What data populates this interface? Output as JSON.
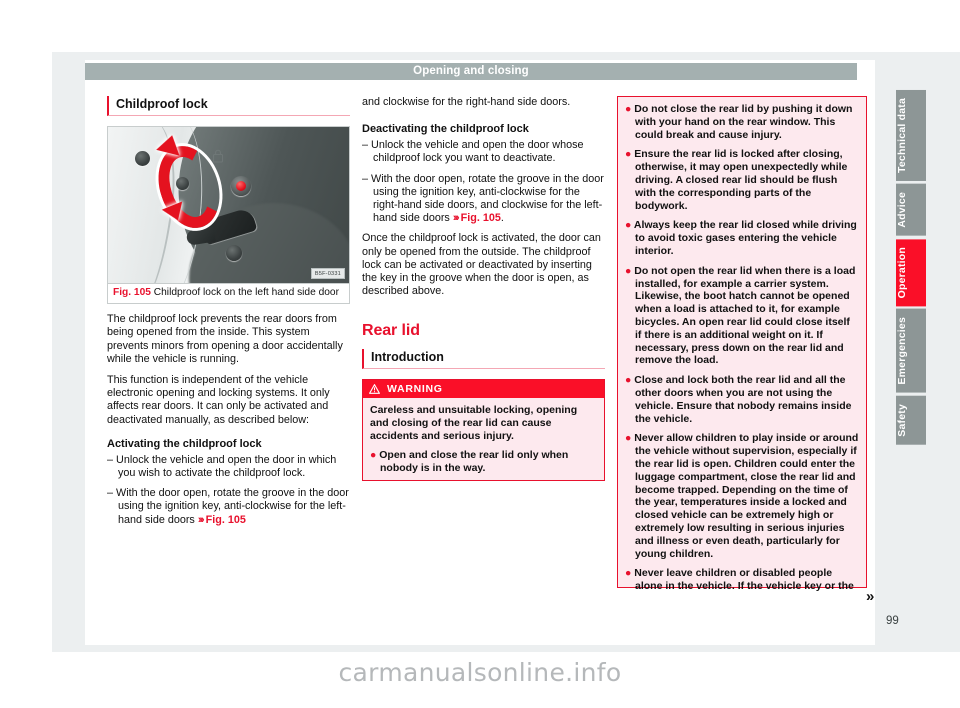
{
  "header": {
    "chapter_title": "Opening and closing"
  },
  "page_number": "99",
  "watermark": "carmanualsonline.info",
  "continuation_marker": "»",
  "left_column": {
    "heading": "Childproof lock",
    "figure": {
      "number": "Fig. 105",
      "caption": "Childproof lock on the left hand side door",
      "image_code": "B5F-0331",
      "alt": "Childproof lock groove on the left hand side door jamb with red rotation arrow"
    },
    "paragraph_1": "The childproof lock prevents the rear doors from being opened from the inside. This system prevents minors from opening a door accidentally while the vehicle is running.",
    "paragraph_2": "This function is independent of the vehicle electronic opening and locking systems. It only affects rear doors. It can only be activated and deactivated manually, as described below:",
    "subheading": "Activating the childproof lock",
    "items": [
      {
        "dash": "–",
        "text": "Unlock the vehicle and open the door in which you wish to activate the childproof lock."
      },
      {
        "dash": "–",
        "text_before": "With the door open, rotate the groove in the door using the ignition key, anti-clockwise for the left-hand side doors ",
        "chevron": "›››",
        "ref": "Fig. 105",
        "text_after": ""
      }
    ]
  },
  "middle_column": {
    "continuation_text": "and clockwise for the right-hand side doors.",
    "subheading": "Deactivating the childproof lock",
    "items": [
      {
        "dash": "–",
        "text": "Unlock the vehicle and open the door whose childproof lock you want to deactivate."
      },
      {
        "dash": "–",
        "text_before": "With the door open, rotate the groove in the door using the ignition key, anti-clockwise for the right-hand side doors, and clockwise for the left-hand side doors ",
        "chevron": "›››",
        "ref": "Fig. 105",
        "text_after": "."
      }
    ],
    "paragraph": "Once the childproof lock is activated, the door can only be opened from the outside. The childproof lock can be activated or deactivated by inserting the key in the groove when the door is open, as described above.",
    "section_heading": "Rear lid",
    "sub_section_heading": "Introduction",
    "warning": {
      "label": "WARNING",
      "icon": "warning-triangle-icon",
      "intro": "Careless and unsuitable locking, opening and closing of the rear lid can cause accidents and serious injury.",
      "bullets": [
        "Open and close the rear lid only when nobody is in the way."
      ]
    }
  },
  "right_column": {
    "warning_bullets": [
      "Do not close the rear lid by pushing it down with your hand on the rear window. This could break and cause injury.",
      "Ensure the rear lid is locked after closing, otherwise, it may open unexpectedly while driving. A closed rear lid should be flush with the corresponding parts of the bodywork.",
      "Always keep the rear lid closed while driving to avoid toxic gases entering the vehicle interior.",
      "Do not open the rear lid when there is a load installed, for example a carrier system. Likewise, the boot hatch cannot be opened when a load is attached to it, for example bicycles. An open rear lid could close itself if there is an additional weight on it. If necessary, press down on the rear lid and remove the load.",
      "Close and lock both the rear lid and all the other doors when you are not using the vehicle. Ensure that nobody remains inside the vehicle.",
      "Never allow children to play inside or around the vehicle without supervision, especially if the rear lid is open. Children could enter the luggage compartment, close the rear lid and become trapped. Depending on the time of the year, temperatures inside a locked and closed vehicle can be extremely high or extremely low resulting in serious injuries and illness or even death, particularly for young children.",
      "Never leave children or disabled people alone in the vehicle. If the vehicle key or the"
    ]
  },
  "tabs": [
    {
      "label": "Technical data",
      "active": false
    },
    {
      "label": "Advice",
      "active": false
    },
    {
      "label": "Operation",
      "active": true
    },
    {
      "label": "Emergencies",
      "active": false
    },
    {
      "label": "Safety",
      "active": false
    }
  ],
  "colors": {
    "accent_red": "#e8112d",
    "header_grey": "#a4b0b0",
    "tab_grey": "#8d9696",
    "warning_bg": "#fde9ee"
  }
}
